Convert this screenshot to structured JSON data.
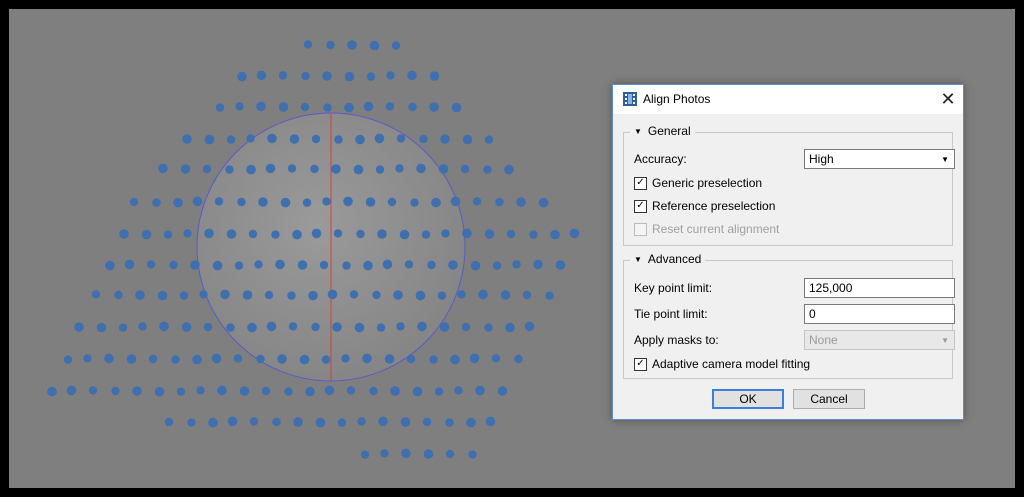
{
  "dialog": {
    "title": "Align Photos",
    "close_symbol": "✕",
    "general": {
      "header": "General",
      "accuracy_label": "Accuracy:",
      "accuracy_value": "High",
      "generic_preselection": {
        "label": "Generic preselection",
        "checked": true
      },
      "reference_preselection": {
        "label": "Reference preselection",
        "checked": true
      },
      "reset_alignment": {
        "label": "Reset current alignment",
        "checked": false,
        "disabled": true
      }
    },
    "advanced": {
      "header": "Advanced",
      "key_point_label": "Key point limit:",
      "key_point_value": "125,000",
      "tie_point_label": "Tie point limit:",
      "tie_point_value": "0",
      "apply_masks_label": "Apply masks to:",
      "apply_masks_value": "None",
      "adaptive_fitting": {
        "label": "Adaptive camera model fitting",
        "checked": true
      }
    },
    "ok_label": "OK",
    "cancel_label": "Cancel"
  },
  "colors": {
    "viewport_bg": "#7f7f7f",
    "camera_marker": "#3f6fae",
    "sphere_axis": "#d04040",
    "sphere_outline": "#5a5ac8"
  },
  "icons": {
    "title": "film-strip-icon",
    "close": "close-icon",
    "collapse": "triangle-down-icon",
    "check": "checkmark-icon",
    "dropdown": "caret-down-icon"
  }
}
